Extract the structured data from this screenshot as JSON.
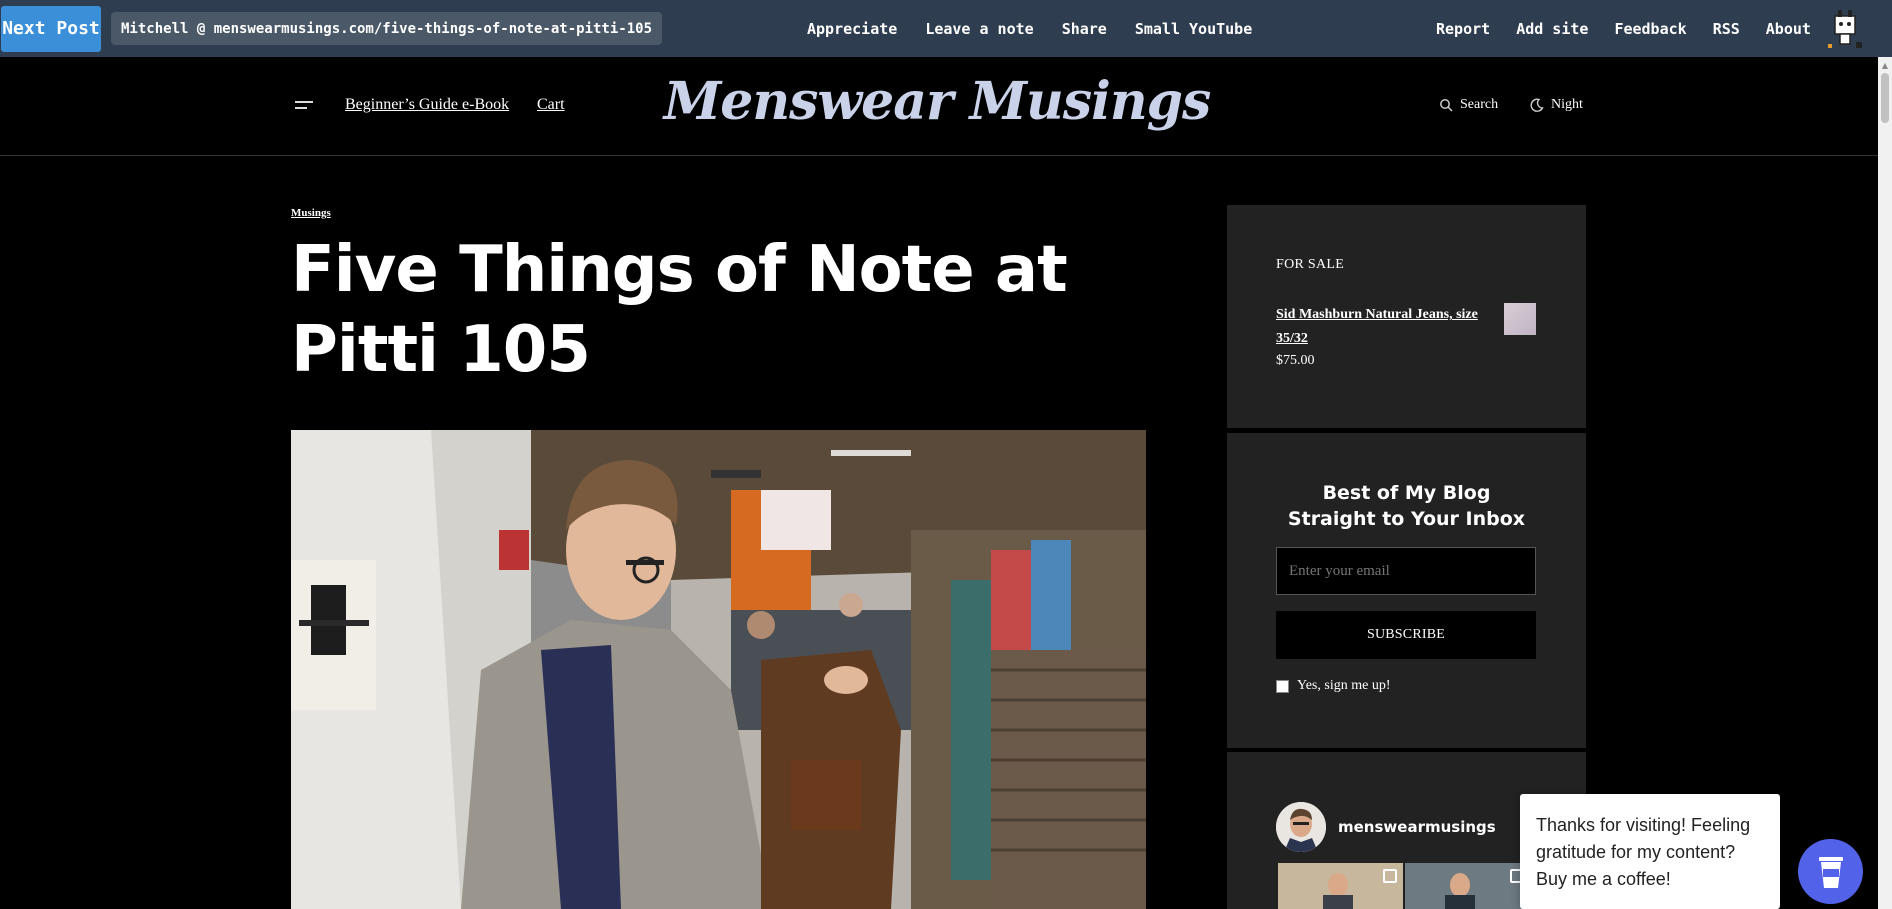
{
  "topbar": {
    "next_post": "Next Post",
    "url": "Mitchell @ menswearmusings.com/five-things-of-note-at-pitti-105",
    "center_links": [
      "Appreciate",
      "Leave a note",
      "Share",
      "Small YouTube"
    ],
    "right_links": [
      "Report",
      "Add site",
      "Feedback",
      "RSS",
      "About"
    ]
  },
  "header": {
    "nav_links": [
      "Beginner’s Guide e-Book",
      "Cart"
    ],
    "logo": "Menswear Musings",
    "search_label": "Search",
    "night_label": "Night"
  },
  "article": {
    "category": "Musings",
    "title": "Five Things of Note at Pitti 105"
  },
  "sidebar": {
    "for_sale": {
      "label": "FOR SALE",
      "item": "Sid Mashburn Natural Jeans, size 35/32",
      "price": "$75.00"
    },
    "newsletter": {
      "title_line1": "Best of My Blog",
      "title_line2": "Straight to Your Inbox",
      "placeholder": "Enter your email",
      "button": "SUBSCRIBE",
      "checkbox_label": "Yes, sign me up!"
    },
    "instagram": {
      "handle": "menswearmusings"
    }
  },
  "coffee": {
    "message": "Thanks for visiting! Feeling gratitude for my content? Buy me a coffee!"
  },
  "colors": {
    "topbar": "#2e3d4f",
    "next_post": "#3a8fd8",
    "logo": "#c9d2e8",
    "widget_bg": "#222222",
    "coffee_button": "#5263ea"
  }
}
